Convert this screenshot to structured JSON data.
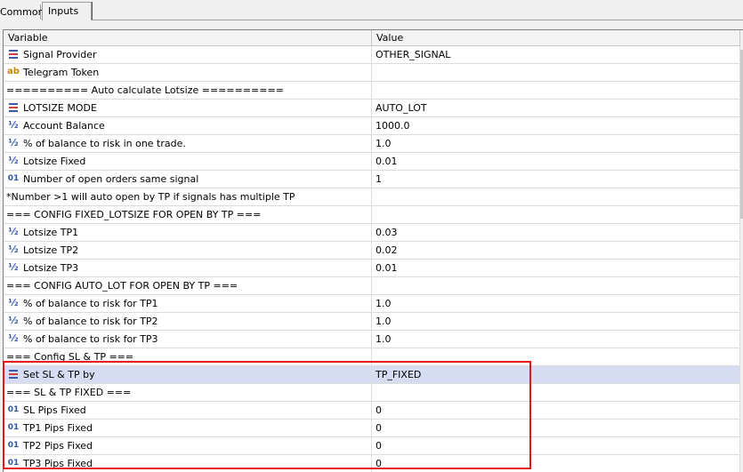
{
  "tabs": [
    {
      "label": "Common"
    },
    {
      "label": "Inputs"
    }
  ],
  "columns": {
    "variable": "Variable",
    "value": "Value"
  },
  "icon_types": {
    "list": "list-enum-icon",
    "ab": "string-icon",
    "half": "double-icon",
    "int": "integer-icon"
  },
  "colors": {
    "highlight": "#e8141b",
    "selected_row": "#d6dcf2"
  },
  "rows": [
    {
      "icon": "list",
      "variable": "Signal Provider",
      "value": "OTHER_SIGNAL"
    },
    {
      "icon": "ab",
      "variable": "Telegram Token",
      "value": ""
    },
    {
      "icon": "",
      "variable": "========== Auto calculate Lotsize ==========",
      "value": ""
    },
    {
      "icon": "list",
      "variable": "LOTSIZE MODE",
      "value": "AUTO_LOT"
    },
    {
      "icon": "half",
      "variable": "Account Balance",
      "value": "1000.0"
    },
    {
      "icon": "half",
      "variable": "% of balance to risk in one trade.",
      "value": "1.0"
    },
    {
      "icon": "half",
      "variable": "Lotsize Fixed",
      "value": "0.01"
    },
    {
      "icon": "int",
      "variable": "Number of open orders same signal",
      "value": "1"
    },
    {
      "icon": "",
      "variable": "*Number >1 will auto open by TP if signals has multiple TP",
      "value": ""
    },
    {
      "icon": "",
      "variable": "=== CONFIG FIXED_LOTSIZE FOR OPEN BY TP ===",
      "value": ""
    },
    {
      "icon": "half",
      "variable": "Lotsize TP1",
      "value": "0.03"
    },
    {
      "icon": "half",
      "variable": "Lotsize TP2",
      "value": "0.02"
    },
    {
      "icon": "half",
      "variable": "Lotsize TP3",
      "value": "0.01"
    },
    {
      "icon": "",
      "variable": "=== CONFIG AUTO_LOT FOR OPEN BY TP ===",
      "value": ""
    },
    {
      "icon": "half",
      "variable": "% of balance to risk for TP1",
      "value": "1.0"
    },
    {
      "icon": "half",
      "variable": "% of balance to risk for TP2",
      "value": "1.0"
    },
    {
      "icon": "half",
      "variable": "% of balance to risk for TP3",
      "value": "1.0"
    },
    {
      "icon": "",
      "variable": "=== Config SL & TP ===",
      "value": ""
    },
    {
      "icon": "list",
      "variable": "Set SL & TP by",
      "value": "TP_FIXED",
      "selected": true
    },
    {
      "icon": "",
      "variable": "=== SL & TP FIXED ===",
      "value": ""
    },
    {
      "icon": "int",
      "variable": "SL Pips Fixed",
      "value": "0"
    },
    {
      "icon": "int",
      "variable": "TP1 Pips Fixed",
      "value": "0"
    },
    {
      "icon": "int",
      "variable": "TP2 Pips Fixed",
      "value": "0"
    },
    {
      "icon": "int",
      "variable": "TP3 Pips Fixed",
      "value": "0"
    }
  ]
}
